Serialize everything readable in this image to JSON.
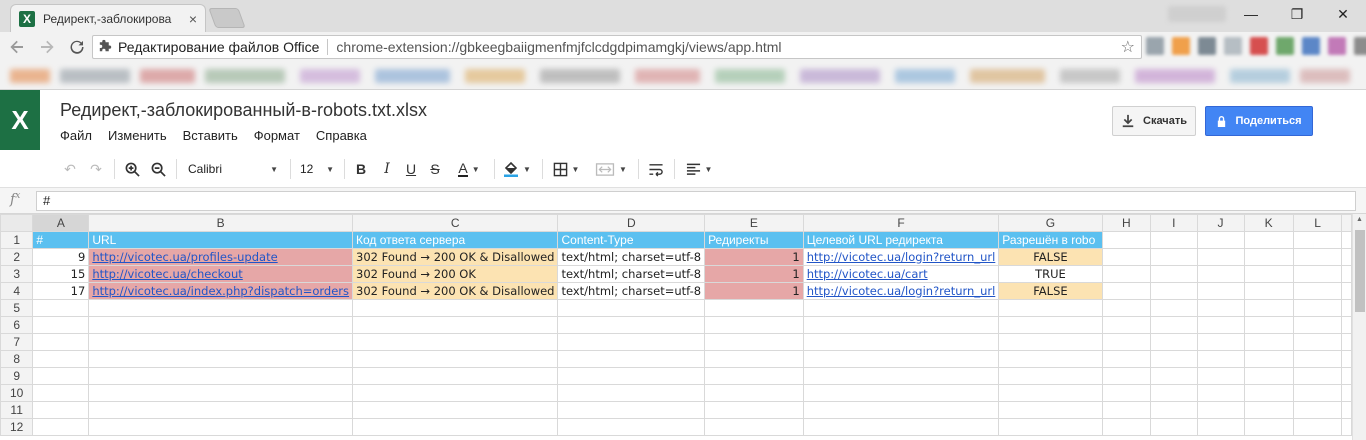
{
  "browser": {
    "tab_title": "Редирект,-заблокирова",
    "tab_close": "×",
    "window_minimize": "—",
    "window_restore": "❐",
    "window_close": "✕",
    "omnibox_title": "Редактирование файлов Office",
    "omnibox_url": "chrome-extension://gbkeegbaiigmenfmjfclcdgdpimamgkj/views/app.html"
  },
  "app": {
    "doc_title": "Редирект,-заблокированный-в-robots.txt.xlsx",
    "menu": [
      "Файл",
      "Изменить",
      "Вставить",
      "Формат",
      "Справка"
    ],
    "download_label": "Скачать",
    "share_label": "Поделиться",
    "accent_color": "#1d7044",
    "share_color": "#4285f4"
  },
  "format_toolbar": {
    "font_family": "Calibri",
    "font_size": "12"
  },
  "formula_bar": {
    "label": "fx",
    "value": "#"
  },
  "sheet": {
    "columns": [
      "A",
      "B",
      "C",
      "D",
      "E",
      "F",
      "G",
      "H",
      "I",
      "J",
      "K",
      "L"
    ],
    "rows": [
      "1",
      "2",
      "3",
      "4",
      "5",
      "6",
      "7",
      "8",
      "9",
      "10",
      "11",
      "12"
    ],
    "header_row": [
      "#",
      "URL",
      "Код ответа сервера",
      "Content-Type",
      "Редиректы",
      "Целевой URL редиректа",
      "Разрешён в robo"
    ],
    "data": [
      [
        "9",
        "http://vicotec.ua/profiles-update",
        "302 Found → 200 OK & Disallowed",
        "text/html; charset=utf-8",
        "1",
        "http://vicotec.ua/login?return_url",
        "FALSE"
      ],
      [
        "15",
        "http://vicotec.ua/checkout",
        "302 Found → 200 OK",
        "text/html; charset=utf-8",
        "1",
        "http://vicotec.ua/cart",
        "TRUE"
      ],
      [
        "17",
        "http://vicotec.ua/index.php?dispatch=orders",
        "302 Found → 200 OK & Disallowed",
        "text/html; charset=utf-8",
        "1",
        "http://vicotec.ua/login?return_url",
        "FALSE"
      ]
    ],
    "colors": {
      "header_fill": "#5bc0f0",
      "red_fill": "#e6a7a7",
      "orange_fill": "#fce3b2",
      "link": "#2155c7"
    }
  }
}
